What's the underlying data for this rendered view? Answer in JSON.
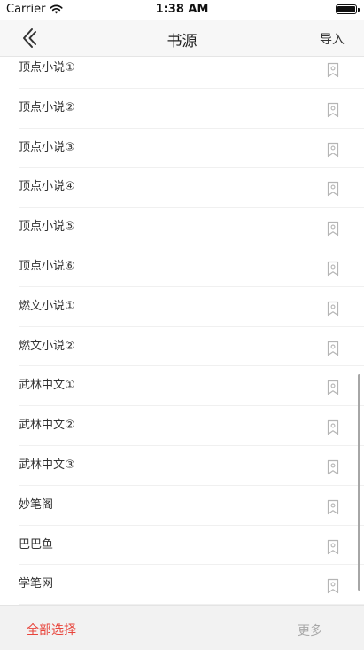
{
  "status": {
    "carrier": "Carrier",
    "time": "1:38 AM",
    "battery_level": 1.0
  },
  "nav": {
    "title": "书源",
    "import_label": "导入"
  },
  "items": [
    {
      "label": "顶点小说①"
    },
    {
      "label": "顶点小说②"
    },
    {
      "label": "顶点小说③"
    },
    {
      "label": "顶点小说④"
    },
    {
      "label": "顶点小说⑤"
    },
    {
      "label": "顶点小说⑥"
    },
    {
      "label": "燃文小说①"
    },
    {
      "label": "燃文小说②"
    },
    {
      "label": "武林中文①"
    },
    {
      "label": "武林中文②"
    },
    {
      "label": "武林中文③"
    },
    {
      "label": "妙笔阁"
    },
    {
      "label": "巴巴鱼"
    },
    {
      "label": "学笔网"
    }
  ],
  "bottom": {
    "select_all_label": "全部选择",
    "more_label": "更多"
  },
  "colors": {
    "accent_red": "#e8453c",
    "disabled_gray": "#a8a8a8",
    "icon_gray": "#b5b5b5"
  }
}
